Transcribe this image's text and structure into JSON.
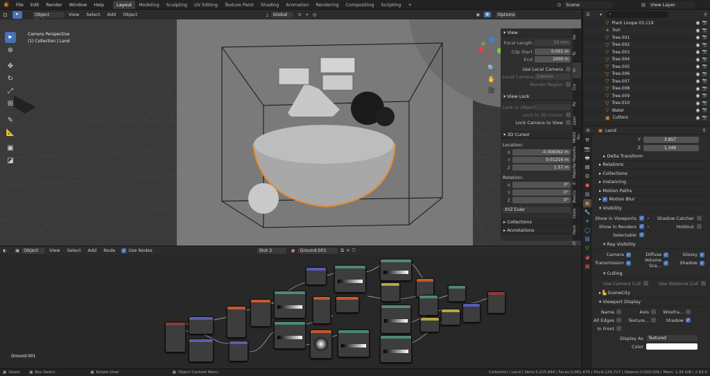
{
  "topbar": {
    "menus": [
      "File",
      "Edit",
      "Render",
      "Window",
      "Help"
    ],
    "workspaces": [
      "Layout",
      "Modeling",
      "Sculpting",
      "UV Editing",
      "Texture Paint",
      "Shading",
      "Animation",
      "Rendering",
      "Compositing",
      "Scripting"
    ],
    "active_workspace": "Layout",
    "add_tab": "+",
    "scene": "Scene",
    "view_layer": "View Layer"
  },
  "viewport_header": {
    "mode": "Object Mode",
    "menus": [
      "View",
      "Select",
      "Add",
      "Object"
    ],
    "orientation": "Global",
    "options": "Options"
  },
  "viewport": {
    "camera_label": "Camera Perspective",
    "collection_label": "(1) Collection | Land"
  },
  "npanel": {
    "view_section": "View",
    "focal_length_label": "Focal Length",
    "focal_length": "50 mm",
    "clip_start_label": "Clip Start",
    "clip_start": "0.001 m",
    "end_label": "End",
    "clip_end": "1000 m",
    "use_local_camera": "Use Local Camera",
    "local_camera_label": "Local Camera",
    "local_camera": "Camera",
    "render_region": "Render Region",
    "view_lock_section": "View Lock",
    "lock_to_object": "Lock to Object",
    "lock_to_3d_cursor": "Lock to 3D Cursor",
    "lock_camera_to_view": "Lock Camera to View",
    "cursor_section": "3D Cursor",
    "location_label": "Location:",
    "x_label": "X",
    "x_val": "-0.008362 m",
    "y_label": "Y",
    "y_val": "0.01216 m",
    "z_label": "Z",
    "z_val": "1.57 m",
    "rotation_label": "Rotation:",
    "rx": "0°",
    "ry": "0°",
    "rz": "0°",
    "euler": "XYZ Euler",
    "collections_section": "Collections",
    "annotations_section": "Annotations",
    "side_tabs": [
      "Ite",
      "To",
      "Vi",
      "Cre",
      "Po",
      "pper",
      "MHX2 Ru",
      "MakeHu",
      "MakeTar",
      "E",
      "BoxCu",
      "Skele",
      "Hard",
      "KIT"
    ]
  },
  "node_header": {
    "editor_type": "Object",
    "menus": [
      "View",
      "Select",
      "Add",
      "Node"
    ],
    "use_nodes": "Use Nodes",
    "slot": "Slot 2",
    "material": "Ground.001"
  },
  "node_editor": {
    "material_label": "Ground.001"
  },
  "outliner": {
    "items": [
      {
        "name": "Plant Linope 03.119",
        "icon": "▽"
      },
      {
        "name": "Sun",
        "icon": "☀"
      },
      {
        "name": "Tree.001",
        "icon": "▽"
      },
      {
        "name": "Tree.002",
        "icon": "▽"
      },
      {
        "name": "Tree.003",
        "icon": "▽"
      },
      {
        "name": "Tree.004",
        "icon": "▽"
      },
      {
        "name": "Tree.005",
        "icon": "▽"
      },
      {
        "name": "Tree.006",
        "icon": "▽"
      },
      {
        "name": "Tree.007",
        "icon": "▽"
      },
      {
        "name": "Tree.008",
        "icon": "▽"
      },
      {
        "name": "Tree.009",
        "icon": "▽"
      },
      {
        "name": "Tree.010",
        "icon": "▽"
      },
      {
        "name": "Water",
        "icon": "▽"
      },
      {
        "name": "Cutters",
        "icon": "▣"
      }
    ]
  },
  "properties": {
    "object_name": "Land",
    "y_label": "Y",
    "y_val": "3.857",
    "z_label": "Z",
    "z_val": "1.349",
    "delta_transform": "Delta Transform",
    "relations": "Relations",
    "collections": "Collections",
    "instancing": "Instancing",
    "motion_paths": "Motion Paths",
    "motion_blur": "Motion Blur",
    "visibility": "Visibility",
    "show_in_viewports": "Show in Viewports",
    "shadow_catcher": "Shadow Catcher",
    "show_in_renders": "Show in Renders",
    "holdout": "Holdout",
    "selectable": "Selectable",
    "ray_visibility": "Ray Visibility",
    "camera": "Camera",
    "diffuse": "Diffuse",
    "glossy": "Glossy",
    "transmission": "Transmission",
    "volume_scatter": "Volume Sca...",
    "shadow": "Shadow",
    "culling": "Culling",
    "use_camera_cull": "Use Camera Cull",
    "use_distance_cull": "Use Distance Cull",
    "scene_city": "SceneCity",
    "viewport_display": "Viewport Display",
    "name": "Name",
    "axis": "Axis",
    "wireframe": "Wirefra...",
    "all_edges": "All Edges",
    "texture_space": "Texture...",
    "shadow2": "Shadow",
    "in_front": "In Front",
    "display_as_label": "Display As",
    "display_as": "Textured",
    "color_label": "Color"
  },
  "statusbar": {
    "select": "Select",
    "box_select": "Box Select",
    "rotate_view": "Rotate View",
    "context_menu": "Object Context Menu",
    "stats": "Collection | Land | Verts:3,225,684 | Faces:3,061,479 | Tris:6,126,727 | Objects:1/100,026 | Mem: 1.39 GiB | 2.83.0"
  },
  "colors": {
    "accent": "#4772b3",
    "selection_orange": "#e8892b",
    "header_bg": "#232323"
  }
}
